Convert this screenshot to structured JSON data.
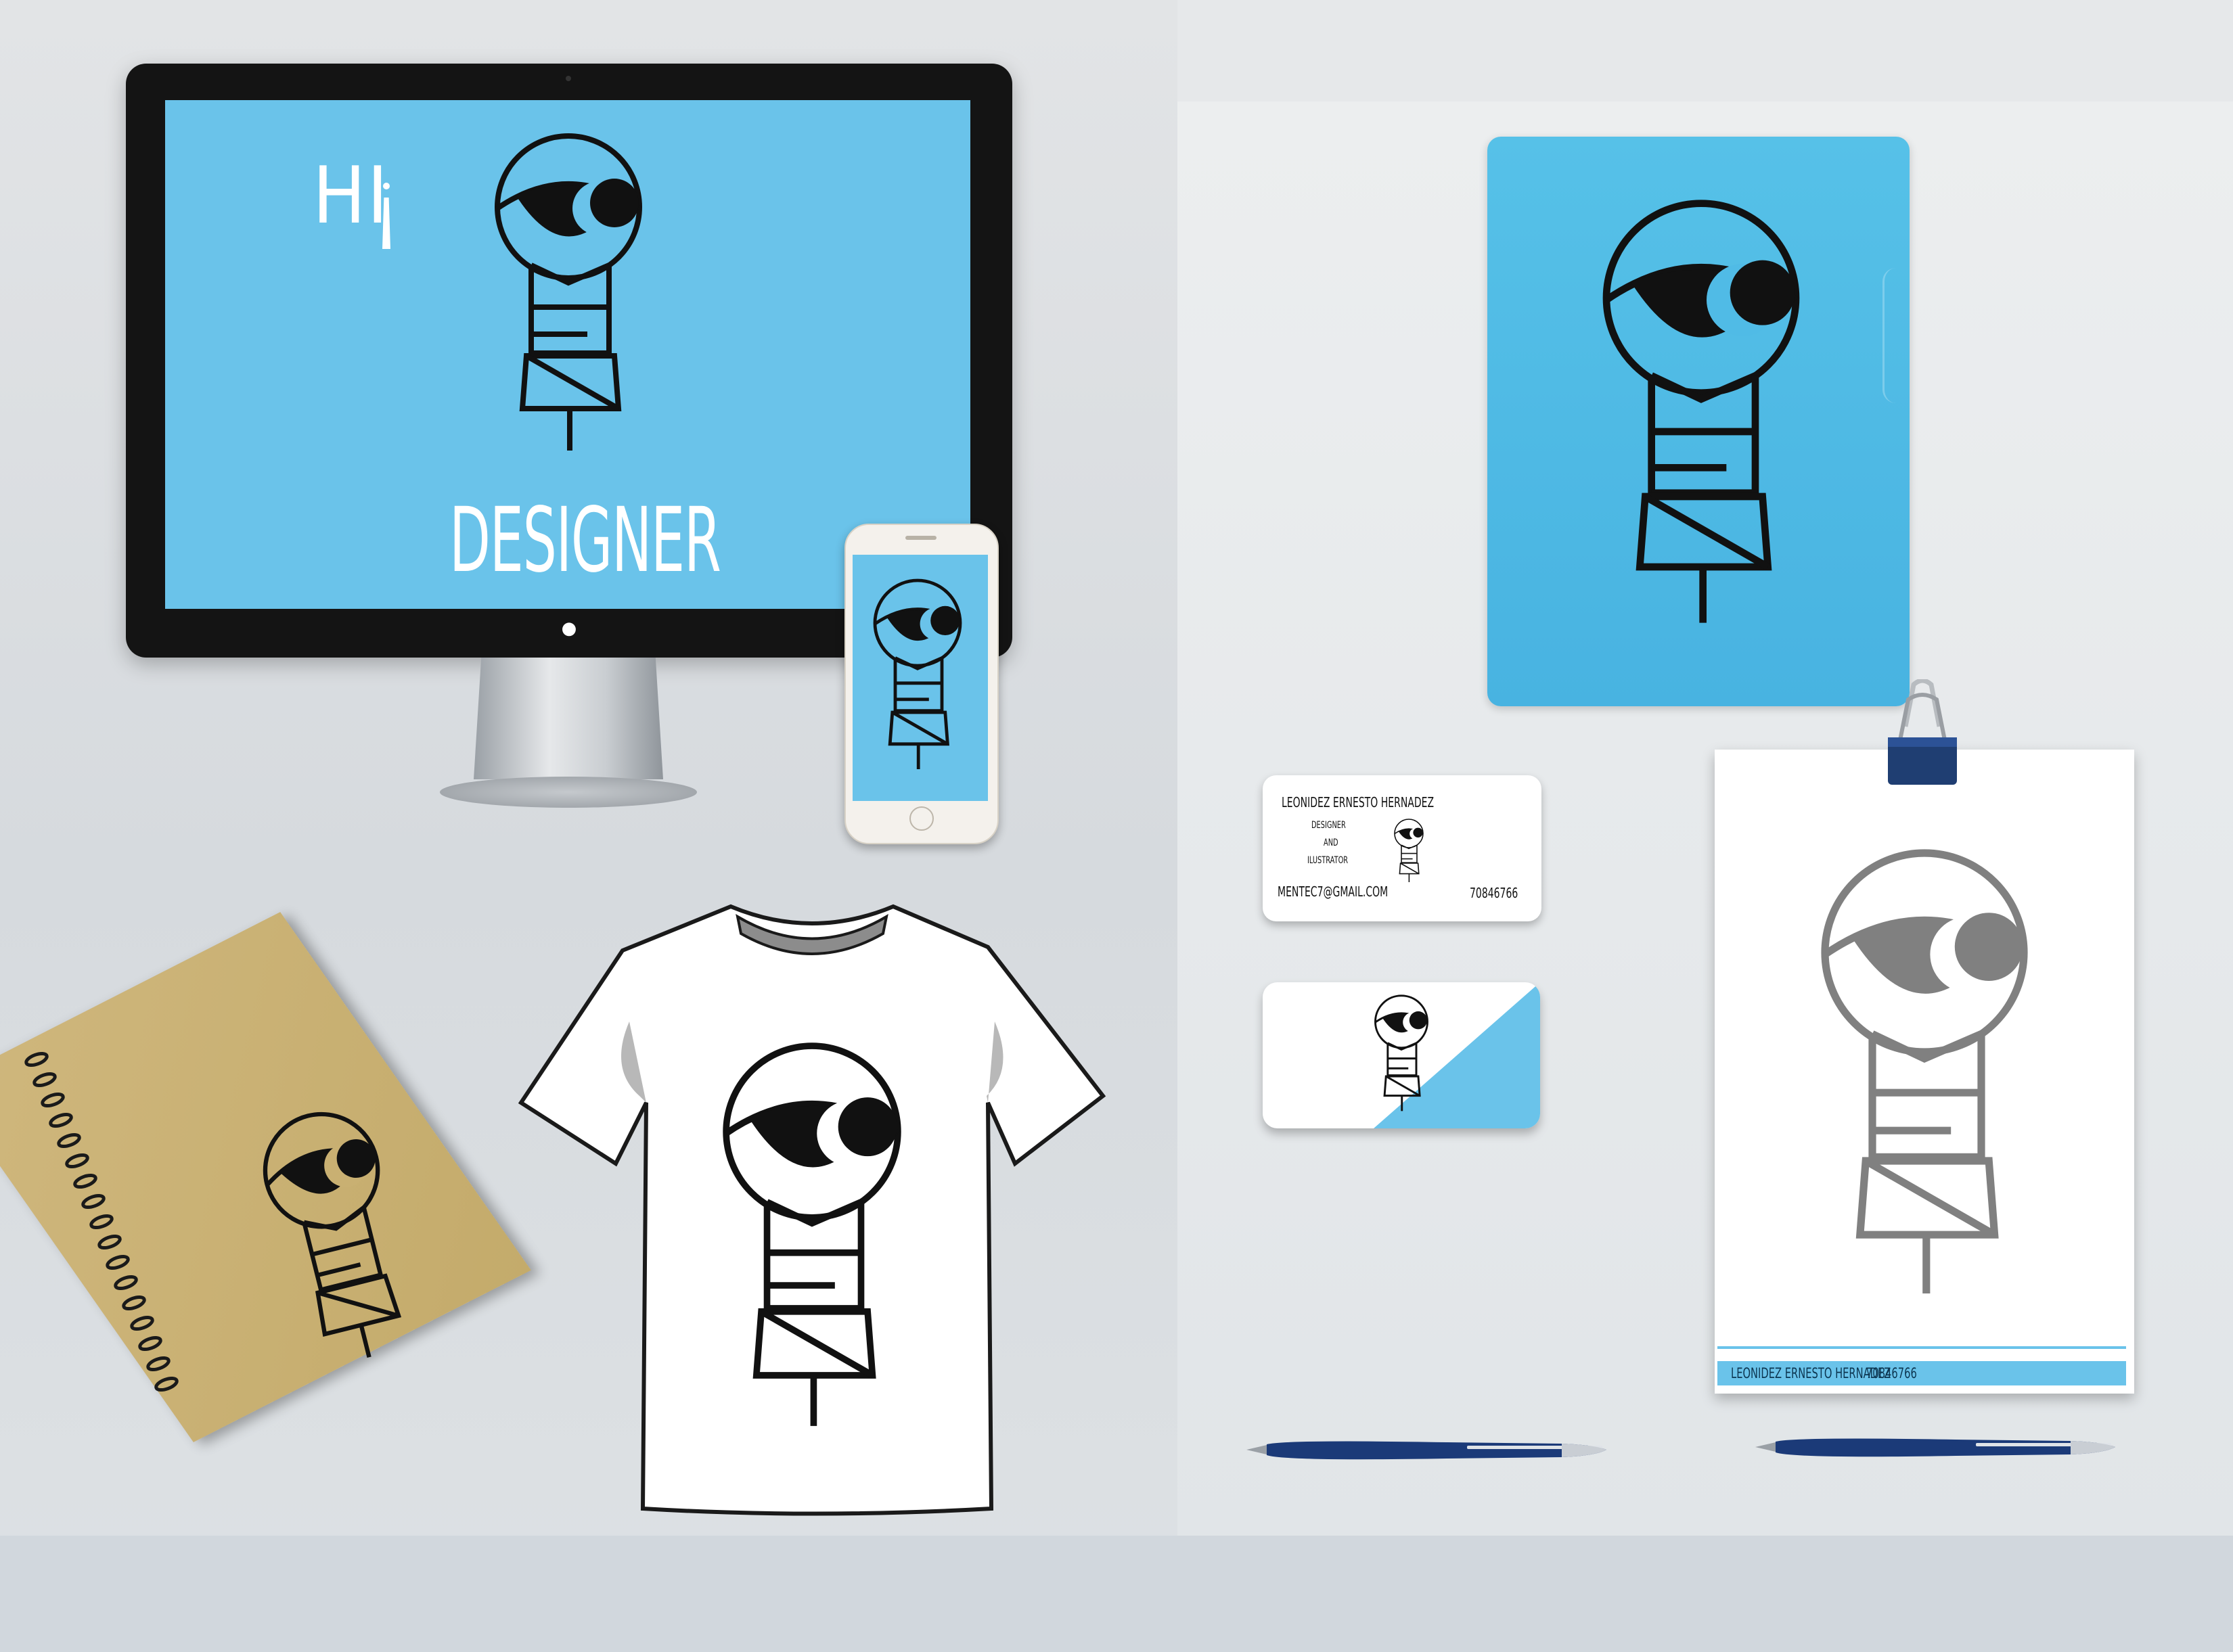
{
  "monitor": {
    "greeting": "HI",
    "subtitle": "DESIGNER",
    "apple_glyph": ""
  },
  "business_card": {
    "name": "LEONIDEZ ERNESTO HERNADEZ",
    "role_line1": "DESIGNER",
    "role_line2": "AND",
    "role_line3": "ILUSTRATOR",
    "email": "MENTEC7@GMAIL.COM",
    "phone": "70846766"
  },
  "letterhead": {
    "name": "LEONIDEZ ERNESTO HERNADEZ",
    "phone": "70846766"
  },
  "colors": {
    "brand_blue": "#6ac3ea",
    "folder_blue": "#4fbbe6",
    "logo_black": "#111111",
    "logo_gray": "#808080",
    "kraft": "#c9b072"
  },
  "icons": [
    "eye-keyhole-logo",
    "apple-logo-icon",
    "binder-clip-icon",
    "pen-icon"
  ]
}
